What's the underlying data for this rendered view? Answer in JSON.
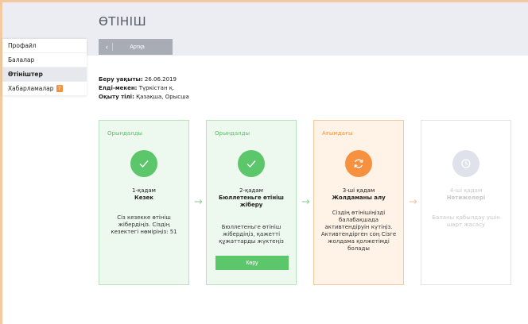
{
  "header": {
    "title": "ӨТІНІШ",
    "back_label": "Артқа"
  },
  "sidebar": {
    "items": [
      {
        "label": "Профайл"
      },
      {
        "label": "Балалар"
      },
      {
        "label": "Өтініштер",
        "active": true
      },
      {
        "label": "Хабарламалар",
        "badge": "7"
      }
    ]
  },
  "application": {
    "submit_date_label": "Беру уақыты:",
    "submit_date": "26.06.2019",
    "locality_label": "Елді-мекен:",
    "locality": "Түркістан қ.",
    "language_label": "Оқыту тілі:",
    "language": "Қазақша, Орысша"
  },
  "steps": [
    {
      "status": "Орындалды",
      "number": "1-қадам",
      "name": "Кезек",
      "description": "Сіз кезекке өтініш жібердіңіз. Сіздің кезектегі нөміріңіз: 51",
      "icon": "check-icon"
    },
    {
      "status": "Орындалды",
      "number": "2-қадам",
      "name": "Бюллетеньге өтініш жіберу",
      "description": "Бюллетеньге өтініш жібердіңіз, қажетті құжаттарды жүктеңіз",
      "button_label": "Көру",
      "icon": "check-icon"
    },
    {
      "status": "Ағымдағы",
      "number": "3-ші қадам",
      "name": "Жолдаманы алу",
      "description": "Сіздің өтінішіңізді балабақшада активтендіруін күтіңіз. Активтендірген соң Сізге жолдама қолжетімді болады",
      "icon": "refresh-icon"
    },
    {
      "status": "",
      "number": "4-ші қадам",
      "name": "Нәтижелері",
      "description": "Баланы қабылдау үшін шарт жасасу",
      "icon": "clock-icon"
    }
  ],
  "colors": {
    "done": "#5cc66a",
    "current": "#f5913f",
    "future": "#dfe2ea"
  }
}
